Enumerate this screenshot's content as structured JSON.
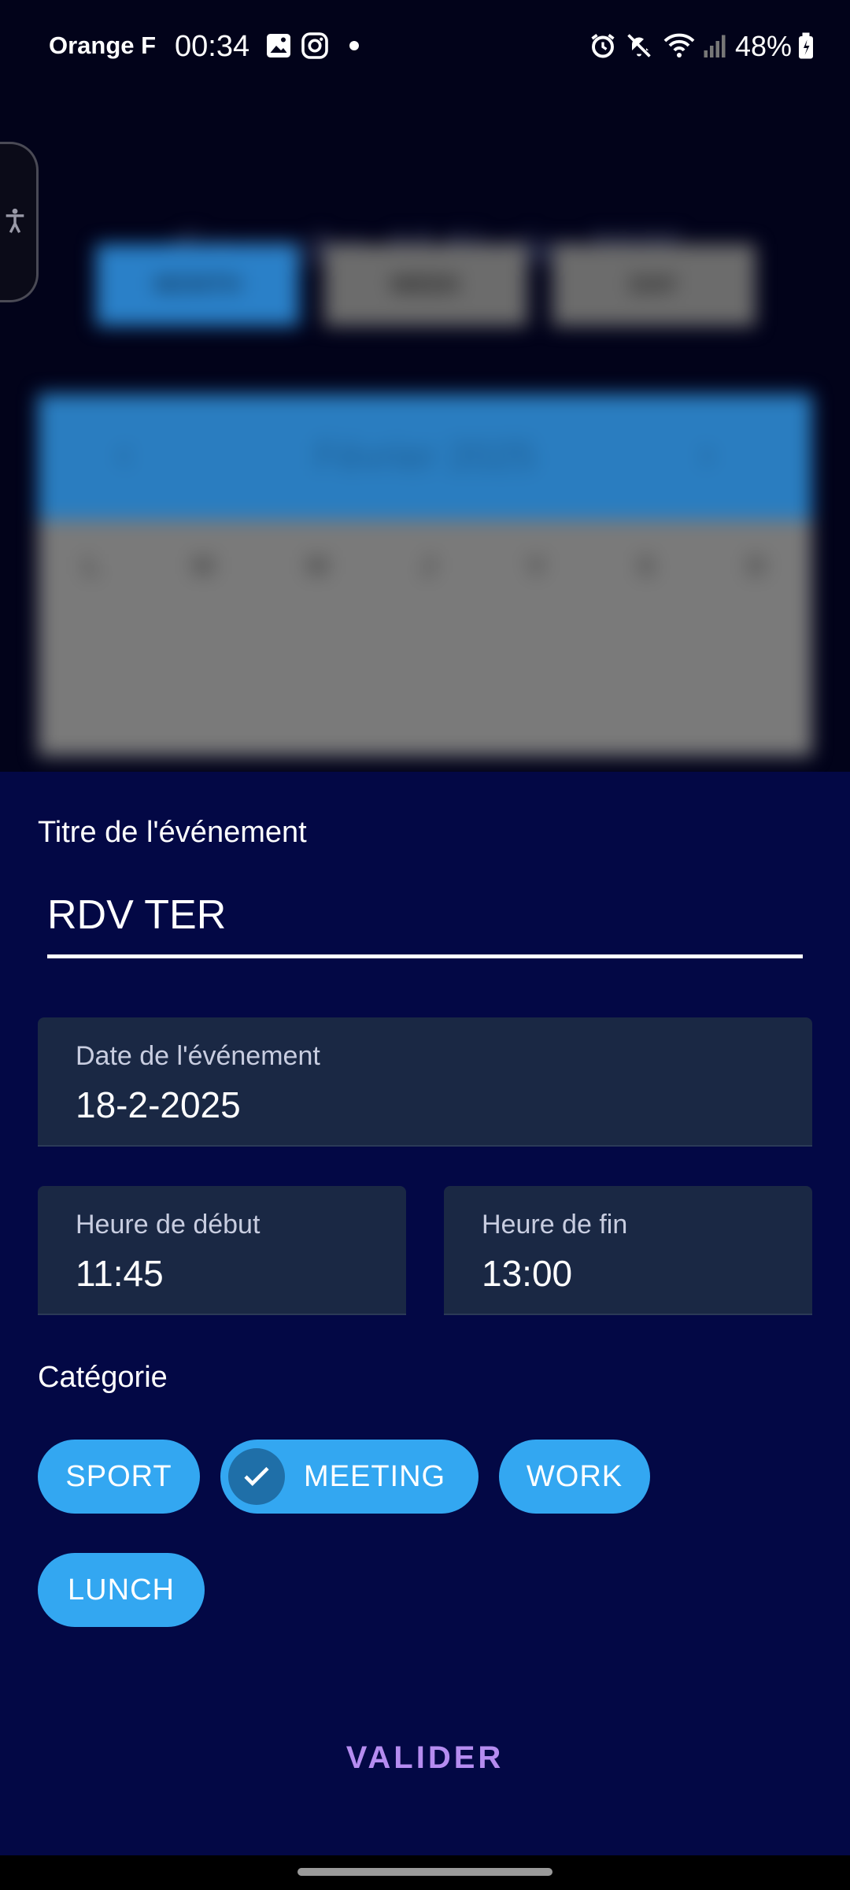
{
  "status_bar": {
    "carrier": "Orange F",
    "time": "00:34",
    "battery": "48%",
    "icons": [
      "gallery-icon",
      "instagram-icon",
      "dot-icon",
      "alarm-icon",
      "mute-icon",
      "wifi-icon",
      "signal-icon",
      "battery-icon"
    ]
  },
  "background_app": {
    "date_title": "dimanche, 16 février 2025",
    "tabs": [
      "MONTH",
      "WEEK",
      "DAY"
    ],
    "calendar_month": "Février 2025",
    "weekdays": [
      "L",
      "M",
      "M",
      "J",
      "V",
      "S",
      "D"
    ]
  },
  "sheet": {
    "title_label": "Titre de l'événement",
    "title_value": "RDV TER",
    "date_label": "Date de l'événement",
    "date_value": "18-2-2025",
    "start_label": "Heure de début",
    "start_value": "11:45",
    "end_label": "Heure de fin",
    "end_value": "13:00",
    "category_label": "Catégorie",
    "categories": [
      {
        "label": "SPORT",
        "selected": false
      },
      {
        "label": "MEETING",
        "selected": true
      },
      {
        "label": "WORK",
        "selected": false
      },
      {
        "label": "LUNCH",
        "selected": false
      }
    ],
    "submit_label": "VALIDER"
  },
  "colors": {
    "sheet_bg": "#030845",
    "chip": "#33a7f1",
    "field_bg": "#1a2844",
    "submit": "#b58cf0"
  }
}
